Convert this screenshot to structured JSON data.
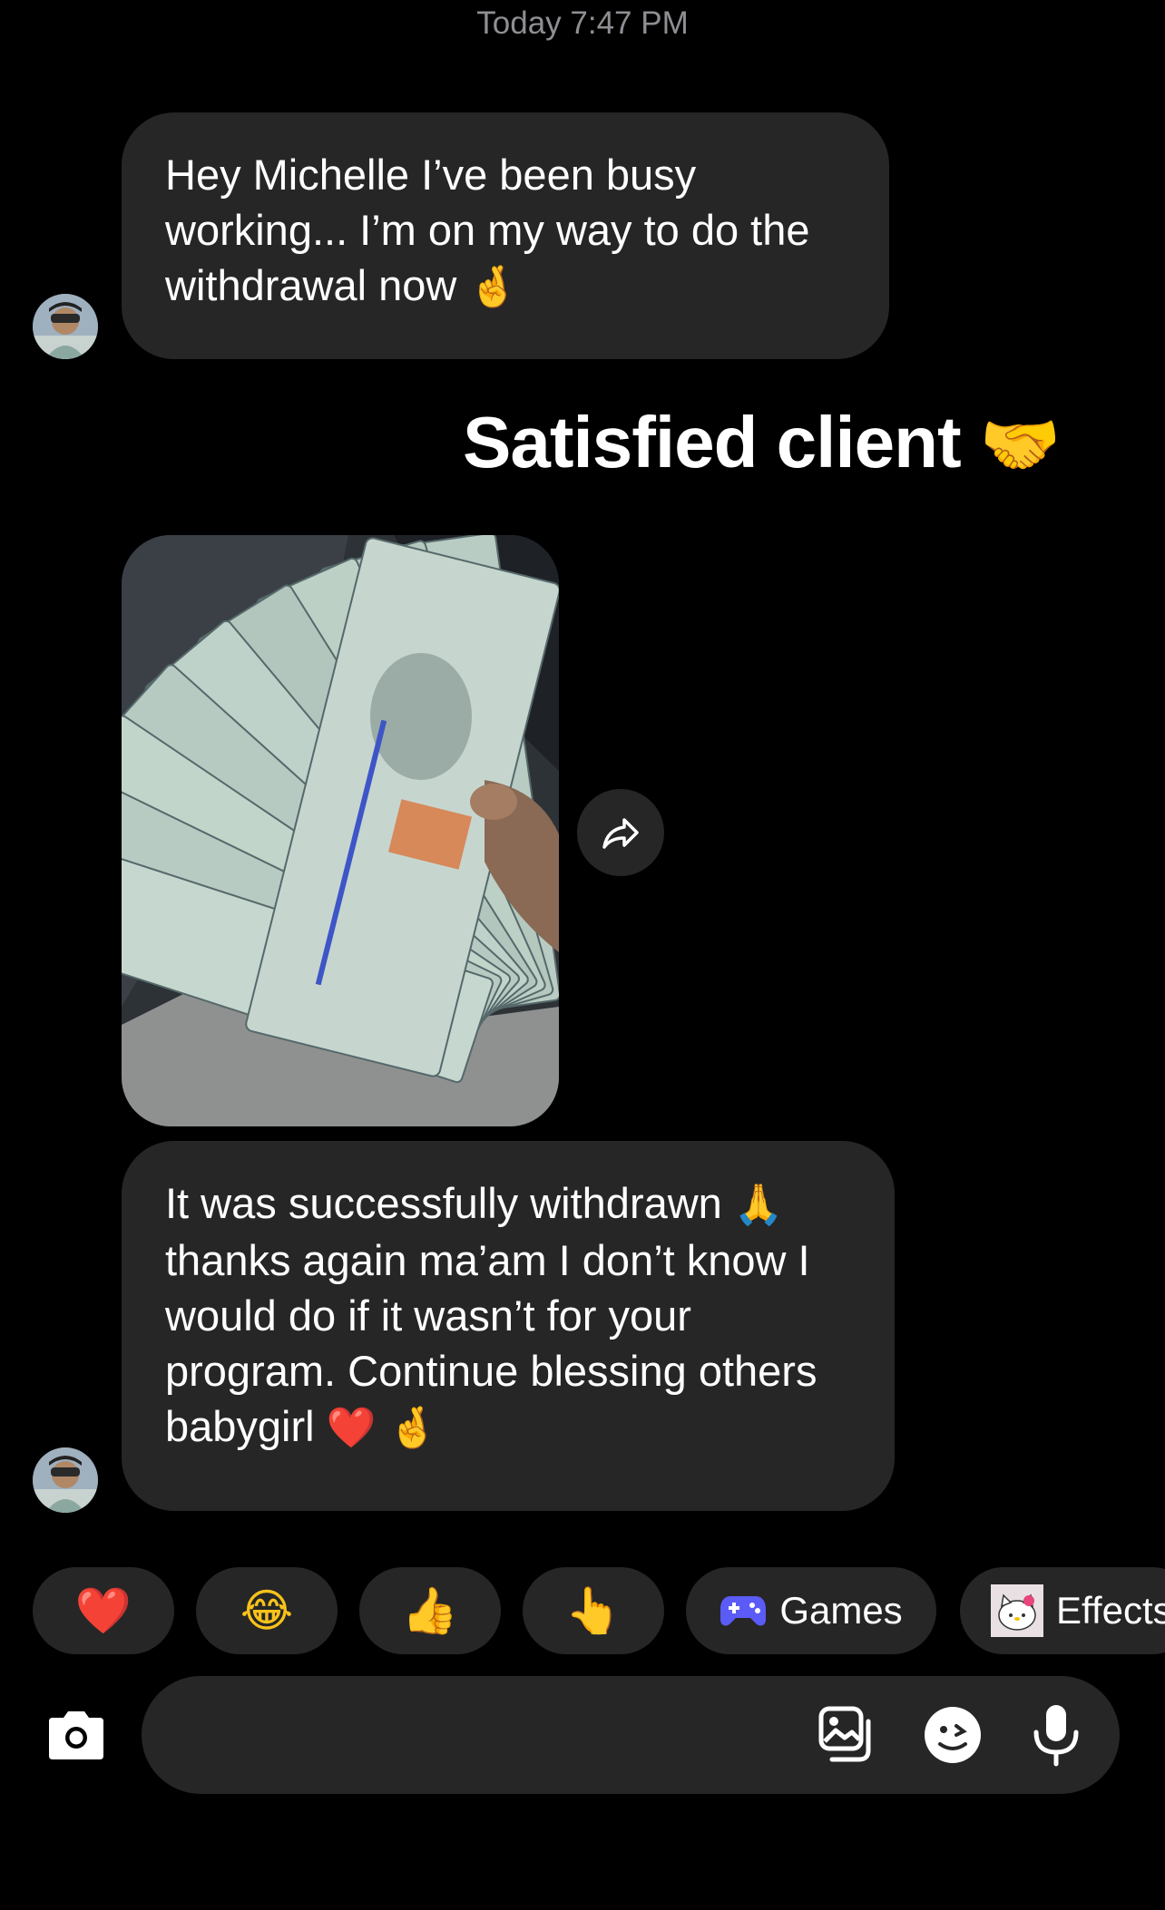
{
  "header": {
    "timestamp": "Today 7:47 PM"
  },
  "messages": [
    {
      "lines": [
        "Hey Michelle I’ve been busy",
        "working... I’m on my way to do the",
        "withdrawal now"
      ],
      "trailing_emoji": [
        "🤞"
      ]
    },
    {
      "caption_text": "Satisfied client",
      "caption_emoji": "🤝",
      "image_subject": "hand holding a fan of 100 dollar bills"
    },
    {
      "lines": [
        "It was successfully withdrawn",
        "thanks again ma’am I don’t know I",
        "would do if it wasn’t for your",
        "program. Continue blessing others",
        "babygirl"
      ],
      "line1_emoji": "🙏",
      "trailing_emoji": [
        "❤️",
        "🤞"
      ]
    }
  ],
  "reactions": [
    {
      "emoji": "❤️"
    },
    {
      "emoji": "😂"
    },
    {
      "emoji": "👍"
    },
    {
      "emoji": "👆"
    },
    {
      "icon": "gamepad-icon",
      "label": "Games"
    },
    {
      "icon": "hello-kitty-effect-icon",
      "label": "Effects"
    }
  ],
  "composer": {
    "placeholder": "",
    "icons": [
      "camera-icon",
      "gallery-icon",
      "sticker-icon",
      "microphone-icon"
    ]
  },
  "colors": {
    "bubble": "#262626",
    "background": "#000000",
    "muted_text": "#8e8e93",
    "games_icon": "#5b5bf7"
  }
}
